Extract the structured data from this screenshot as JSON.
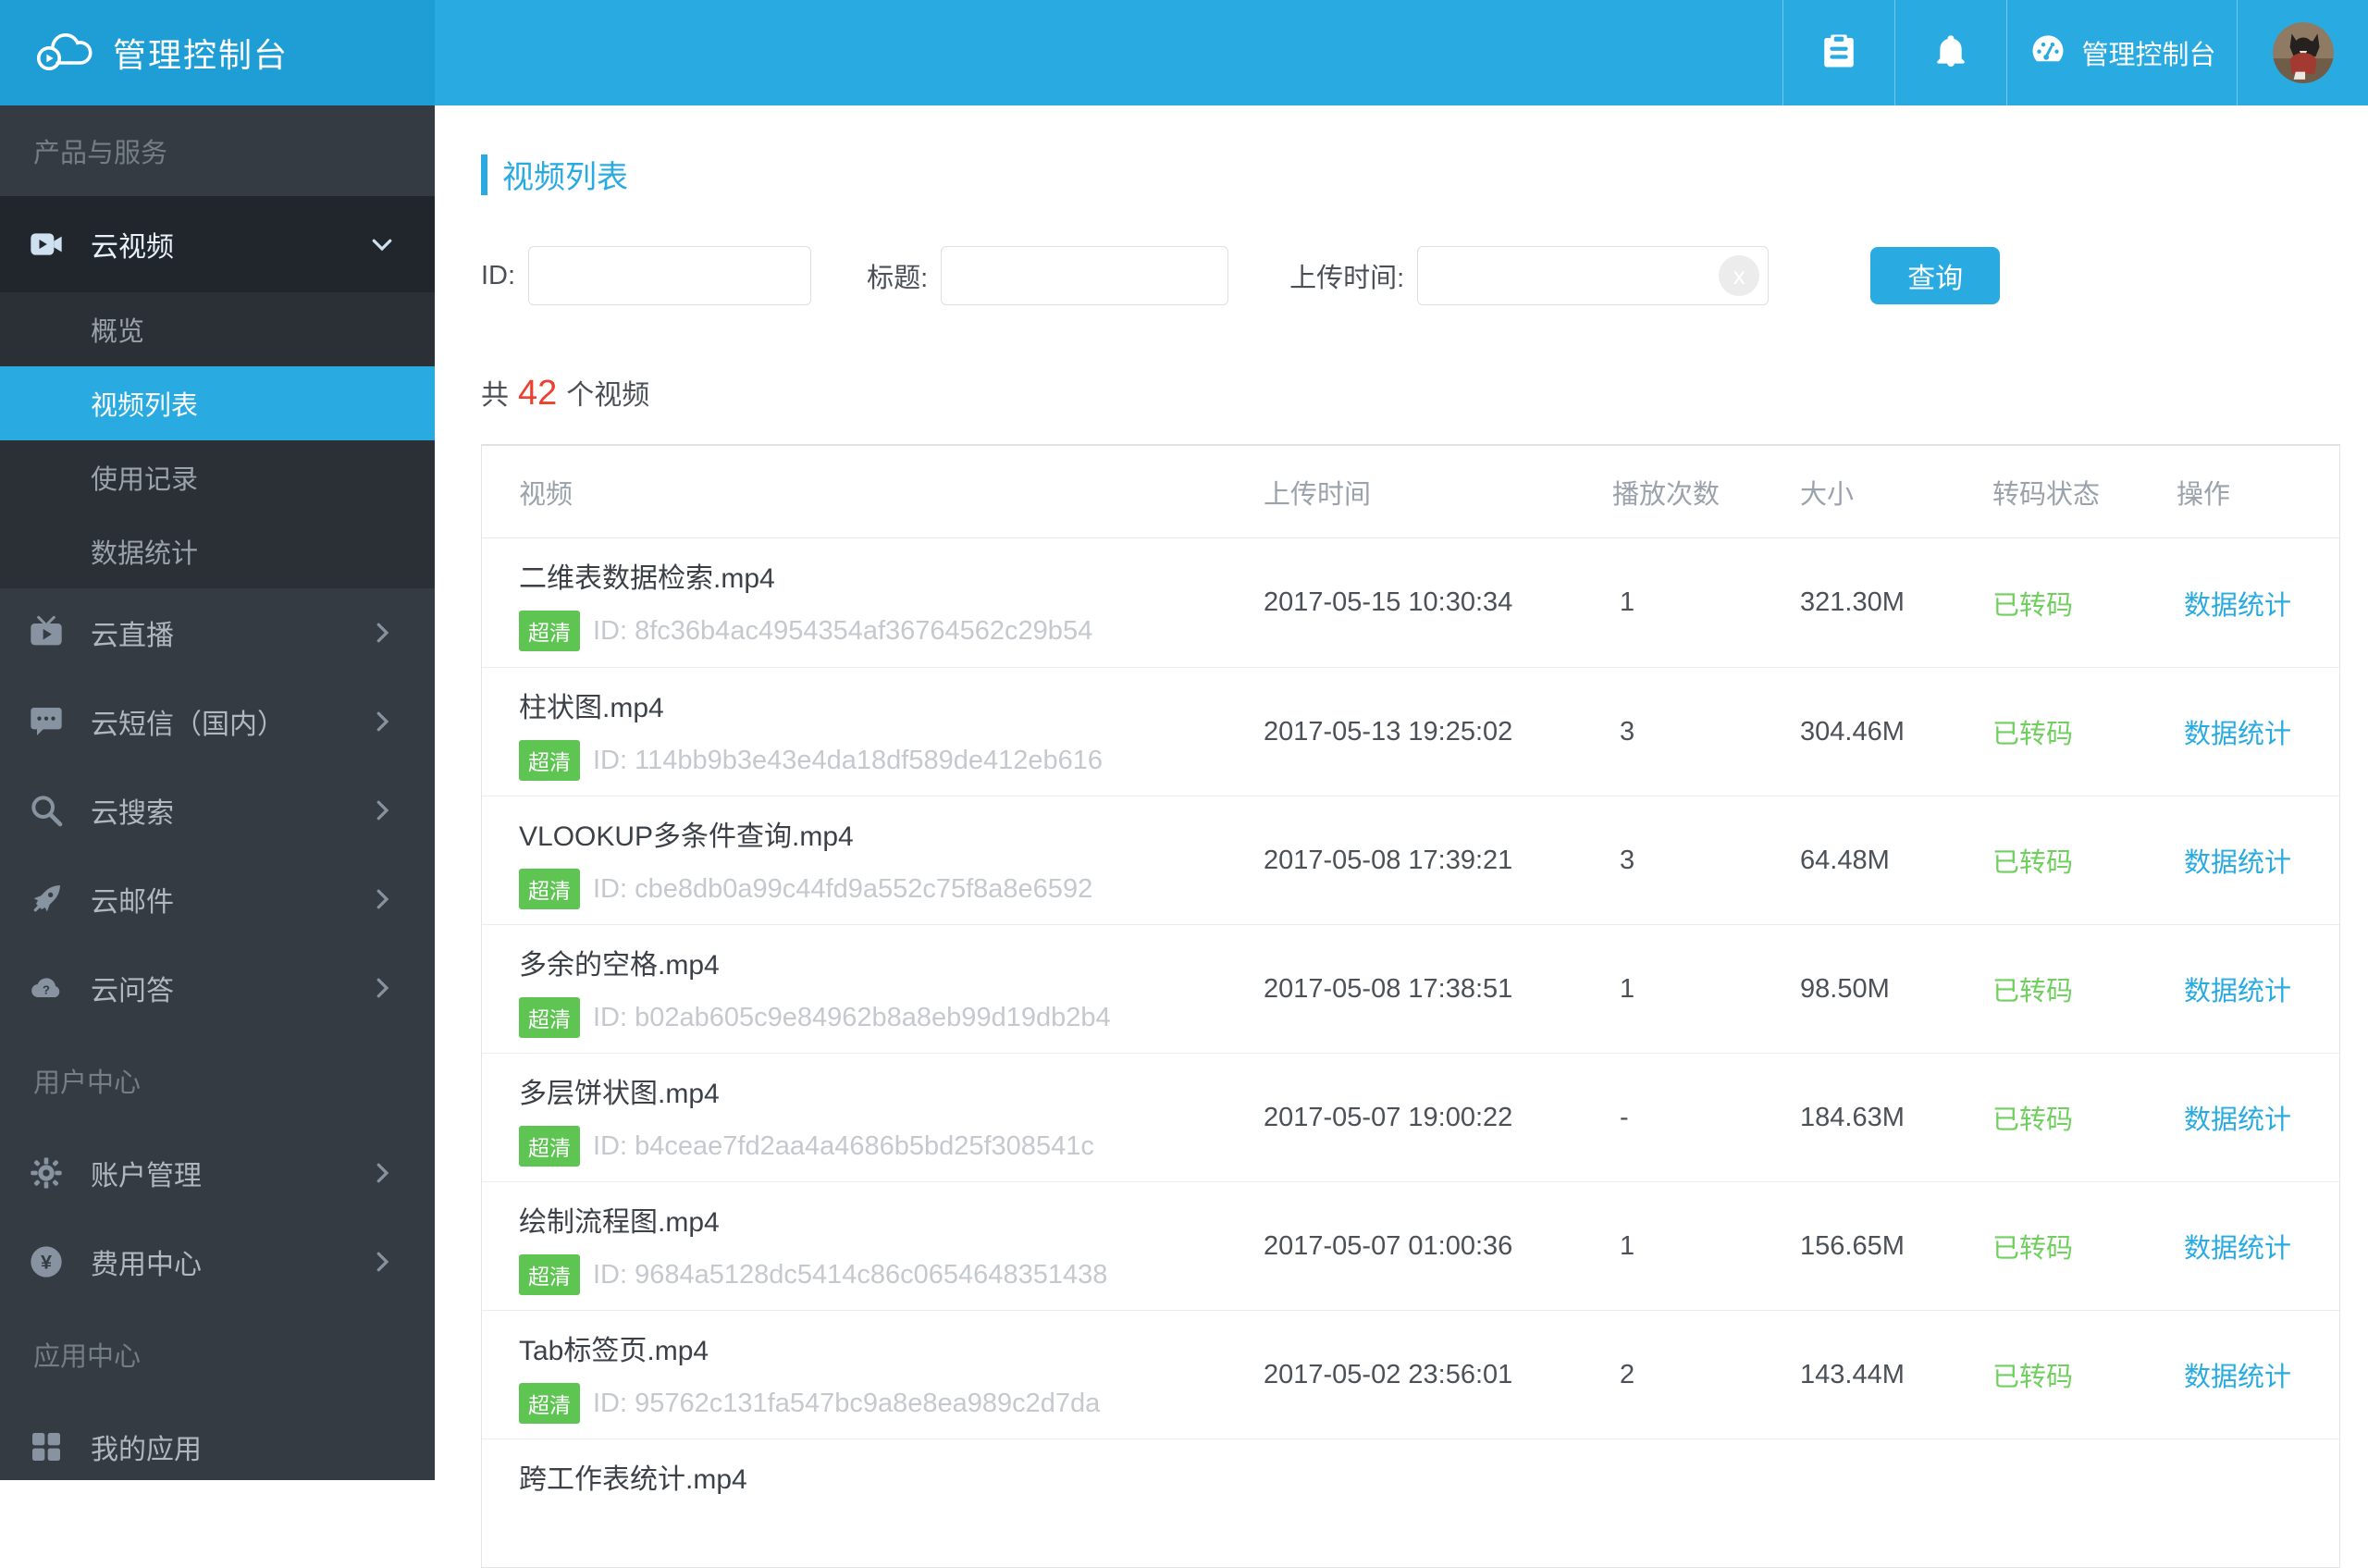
{
  "topbar": {
    "logo_title": "管理控制台",
    "icons": [
      "clipboard-icon",
      "bell-icon",
      "dashboard-icon"
    ],
    "console_label": "管理控制台",
    "avatar": "cat-photo"
  },
  "sidebar": {
    "section_products": "产品与服务",
    "video_group": {
      "label": "云视频",
      "icon": "video-camera-icon",
      "expanded": true,
      "items": [
        {
          "label": "概览",
          "active": false
        },
        {
          "label": "视频列表",
          "active": true
        },
        {
          "label": "使用记录",
          "active": false
        },
        {
          "label": "数据统计",
          "active": false
        }
      ]
    },
    "services": [
      {
        "label": "云直播",
        "icon": "live-tv-icon"
      },
      {
        "label": "云短信（国内）",
        "icon": "sms-bubble-icon"
      },
      {
        "label": "云搜索",
        "icon": "search-icon"
      },
      {
        "label": "云邮件",
        "icon": "rocket-icon"
      },
      {
        "label": "云问答",
        "icon": "cloud-question-icon"
      }
    ],
    "section_user": "用户中心",
    "user_items": [
      {
        "label": "账户管理",
        "icon": "gear-icon"
      },
      {
        "label": "费用中心",
        "icon": "yen-circle-icon"
      }
    ],
    "section_app": "应用中心",
    "app_items": [
      {
        "label": "我的应用",
        "icon": "grid-icon"
      }
    ]
  },
  "main": {
    "page_title": "视频列表",
    "filters": {
      "id_label": "ID:",
      "title_label": "标题:",
      "time_label": "上传时间:",
      "id_value": "",
      "title_value": "",
      "time_value": "",
      "clear_label": "x",
      "search_button": "查询"
    },
    "count": {
      "prefix": "共",
      "number": "42",
      "suffix": "个视频"
    },
    "table": {
      "headers": [
        "视频",
        "上传时间",
        "播放次数",
        "大小",
        "转码状态",
        "操作"
      ],
      "rows": [
        {
          "name": "二维表数据检索.mp4",
          "quality": "超清",
          "id": "ID: 8fc36b4ac4954354af36764562c29b54",
          "uploaded": "2017-05-15 10:30:34",
          "plays": "1",
          "size": "321.30M",
          "status": "已转码",
          "action": "数据统计"
        },
        {
          "name": "柱状图.mp4",
          "quality": "超清",
          "id": "ID: 114bb9b3e43e4da18df589de412eb616",
          "uploaded": "2017-05-13 19:25:02",
          "plays": "3",
          "size": "304.46M",
          "status": "已转码",
          "action": "数据统计"
        },
        {
          "name": "VLOOKUP多条件查询.mp4",
          "quality": "超清",
          "id": "ID: cbe8db0a99c44fd9a552c75f8a8e6592",
          "uploaded": "2017-05-08 17:39:21",
          "plays": "3",
          "size": "64.48M",
          "status": "已转码",
          "action": "数据统计"
        },
        {
          "name": "多余的空格.mp4",
          "quality": "超清",
          "id": "ID: b02ab605c9e84962b8a8eb99d19db2b4",
          "uploaded": "2017-05-08 17:38:51",
          "plays": "1",
          "size": "98.50M",
          "status": "已转码",
          "action": "数据统计"
        },
        {
          "name": "多层饼状图.mp4",
          "quality": "超清",
          "id": "ID: b4ceae7fd2aa4a4686b5bd25f308541c",
          "uploaded": "2017-05-07 19:00:22",
          "plays": "-",
          "size": "184.63M",
          "status": "已转码",
          "action": "数据统计"
        },
        {
          "name": "绘制流程图.mp4",
          "quality": "超清",
          "id": "ID: 9684a5128dc5414c86c0654648351438",
          "uploaded": "2017-05-07 01:00:36",
          "plays": "1",
          "size": "156.65M",
          "status": "已转码",
          "action": "数据统计"
        },
        {
          "name": "Tab标签页.mp4",
          "quality": "超清",
          "id": "ID: 95762c131fa547bc9a8e8ea989c2d7da",
          "uploaded": "2017-05-02 23:56:01",
          "plays": "2",
          "size": "143.44M",
          "status": "已转码",
          "action": "数据统计"
        },
        {
          "name": "跨工作表统计.mp4"
        }
      ]
    }
  },
  "colors": {
    "accent": "#29abe2",
    "logo-bg": "#1f9ed6",
    "sidebar-bg": "#343b42",
    "group-bg": "#2a3036",
    "group-head-bg": "#20262b",
    "badge-green": "#5ec452",
    "status-green": "#70cf5f",
    "count-red": "#ed402e"
  }
}
